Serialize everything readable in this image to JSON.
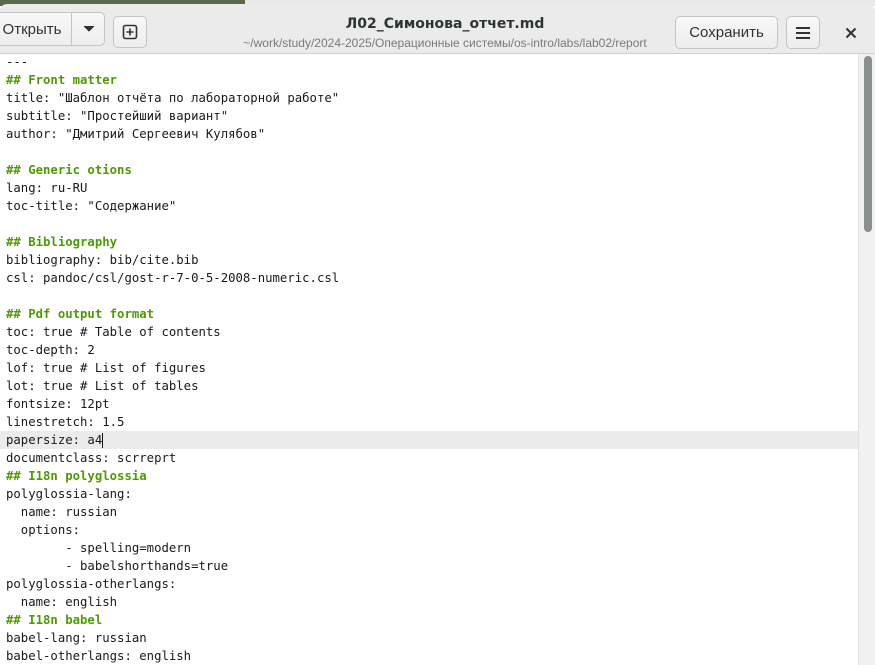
{
  "header": {
    "open_label": "Открыть",
    "save_label": "Сохранить",
    "title": "Л02_Симонова_отчет.md",
    "path": "~/work/study/2024-2025/Операционные системы/os-intro/labs/lab02/report"
  },
  "icons": {
    "open_dropdown": "chevron-down-icon",
    "new_tab": "new-tab-icon",
    "menu": "hamburger-menu-icon",
    "close": "close-icon"
  },
  "colors": {
    "heading": "#4e9a06",
    "text": "#1a1a1a",
    "current_line": "#ebebeb",
    "headerbar": "#ebebeb"
  },
  "editor": {
    "current_line_index": 21,
    "lines": [
      {
        "text": "---",
        "heading": false
      },
      {
        "text": "## Front matter",
        "heading": true
      },
      {
        "text": "title: \"Шаблон отчёта по лабораторной работе\"",
        "heading": false
      },
      {
        "text": "subtitle: \"Простейший вариант\"",
        "heading": false
      },
      {
        "text": "author: \"Дмитрий Сергеевич Кулябов\"",
        "heading": false
      },
      {
        "text": "",
        "heading": false
      },
      {
        "text": "## Generic otions",
        "heading": true
      },
      {
        "text": "lang: ru-RU",
        "heading": false
      },
      {
        "text": "toc-title: \"Содержание\"",
        "heading": false
      },
      {
        "text": "",
        "heading": false
      },
      {
        "text": "## Bibliography",
        "heading": true
      },
      {
        "text": "bibliography: bib/cite.bib",
        "heading": false
      },
      {
        "text": "csl: pandoc/csl/gost-r-7-0-5-2008-numeric.csl",
        "heading": false
      },
      {
        "text": "",
        "heading": false
      },
      {
        "text": "## Pdf output format",
        "heading": true
      },
      {
        "text": "toc: true # Table of contents",
        "heading": false
      },
      {
        "text": "toc-depth: 2",
        "heading": false
      },
      {
        "text": "lof: true # List of figures",
        "heading": false
      },
      {
        "text": "lot: true # List of tables",
        "heading": false
      },
      {
        "text": "fontsize: 12pt",
        "heading": false
      },
      {
        "text": "linestretch: 1.5",
        "heading": false
      },
      {
        "text": "papersize: a4",
        "heading": false
      },
      {
        "text": "documentclass: scrreprt",
        "heading": false
      },
      {
        "text": "## I18n polyglossia",
        "heading": true
      },
      {
        "text": "polyglossia-lang:",
        "heading": false
      },
      {
        "text": "  name: russian",
        "heading": false
      },
      {
        "text": "  options:",
        "heading": false
      },
      {
        "text": "        - spelling=modern",
        "heading": false
      },
      {
        "text": "        - babelshorthands=true",
        "heading": false
      },
      {
        "text": "polyglossia-otherlangs:",
        "heading": false
      },
      {
        "text": "  name: english",
        "heading": false
      },
      {
        "text": "## I18n babel",
        "heading": true
      },
      {
        "text": "babel-lang: russian",
        "heading": false
      },
      {
        "text": "babel-otherlangs: english",
        "heading": false
      }
    ]
  }
}
